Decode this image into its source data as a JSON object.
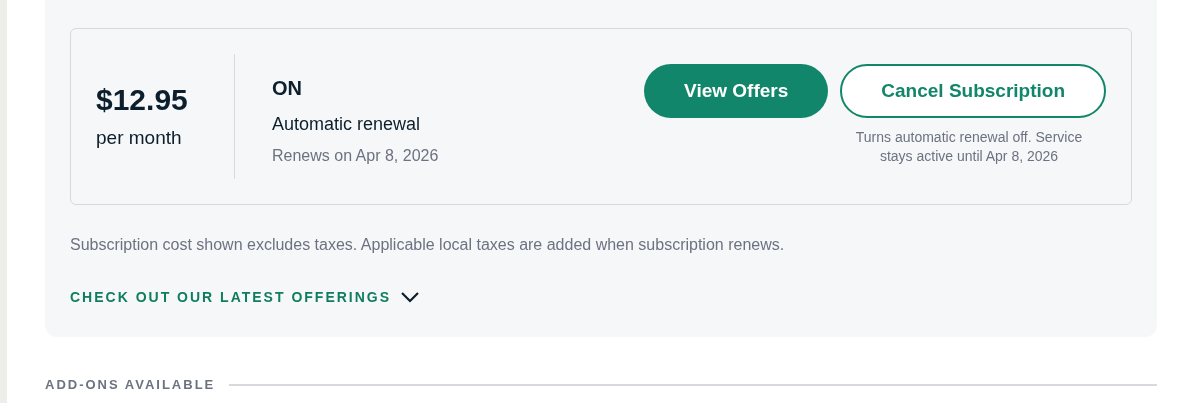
{
  "subscription": {
    "price": "$12.95",
    "period": "per month",
    "renewal_status": "ON",
    "renewal_label": "Automatic renewal",
    "renewal_date": "Renews on Apr 8, 2026",
    "buttons": [
      {
        "label": "View Offers",
        "kind": "primary"
      },
      {
        "label": "Cancel Subscription",
        "kind": "outline"
      }
    ],
    "cancel_note": "Turns automatic renewal off. Service stays active until Apr 8, 2026"
  },
  "tax_note": "Subscription cost shown excludes taxes. Applicable local taxes are added when subscription renews.",
  "offerings_link": {
    "label": "CHECK OUT OUR LATEST OFFERINGS",
    "expanded": false
  },
  "addons_heading": "ADD-ONS AVAILABLE"
}
